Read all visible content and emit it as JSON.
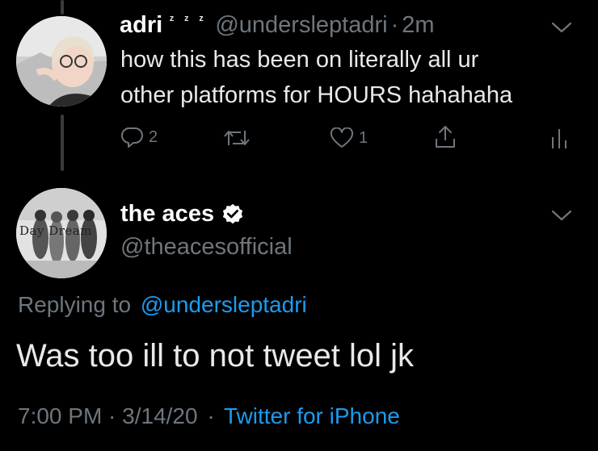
{
  "reply_tweet": {
    "name": "adri",
    "name_suffix": "ᶻ ᶻ ᶻ",
    "handle": "@undersleptadri",
    "separator": "·",
    "time": "2m",
    "text_line1": "how this has been on literally all ur",
    "text_line2": "other platforms for HOURS hahahaha",
    "actions": {
      "reply_count": "2",
      "retweet_count": "",
      "like_count": "1"
    },
    "icons": [
      "reply-icon",
      "retweet-icon",
      "like-icon",
      "share-icon",
      "analytics-icon",
      "chevron-down-icon"
    ]
  },
  "main_tweet": {
    "name": "the aces",
    "handle": "@theacesofficial",
    "avatar_label": "Day Dream",
    "replying_prefix": "Replying to",
    "replying_handle": "@undersleptadri",
    "text": "Was too ill to not tweet lol jk",
    "timestamp": "7:00 PM · 3/14/20",
    "meta_separator": "·",
    "source": "Twitter for iPhone",
    "icons": [
      "verified-badge-icon",
      "chevron-down-icon"
    ]
  },
  "colors": {
    "background": "#000000",
    "secondary_text": "#6e767d",
    "link": "#1d9bf0",
    "thread_line": "#3a3a3a"
  }
}
